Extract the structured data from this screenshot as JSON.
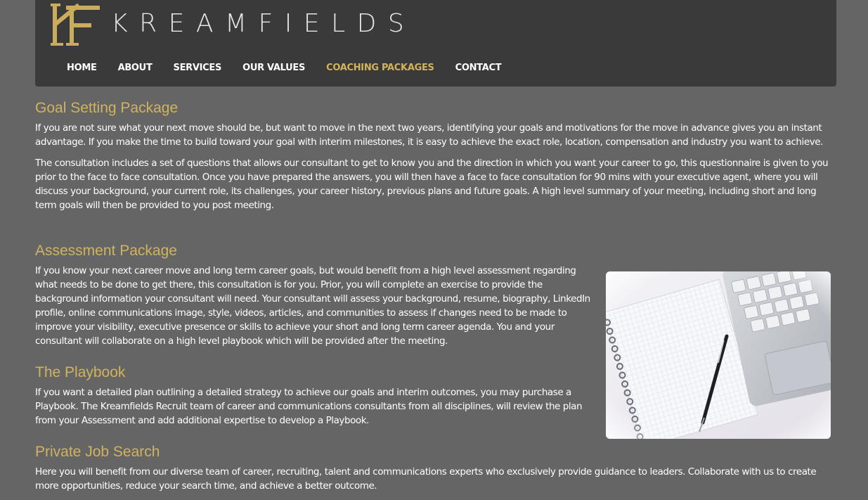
{
  "brand": {
    "name": "KREAMFIELDS",
    "mark_color": "#c9ad5d"
  },
  "nav": {
    "items": [
      {
        "label": "HOME"
      },
      {
        "label": "ABOUT"
      },
      {
        "label": "SERVICES"
      },
      {
        "label": "OUR VALUES"
      },
      {
        "label": "COACHING PACKAGES",
        "active": true
      },
      {
        "label": "CONTACT"
      }
    ]
  },
  "colors": {
    "accent": "#d1b35e",
    "background": "#656565",
    "header": "#3b3a3b"
  },
  "sections": [
    {
      "title": "Goal Setting Package",
      "paragraphs": [
        "If you are not sure what your next move should be, but want to move in the next two years, identifying your goals and motivations for the move in advance gives you an instant advantage. If you make the time to build toward your goal with interim milestones, it is easy to achieve the exact role, location, compensation and industry you want to achieve.",
        "The consultation includes a set of questions that allows our consultant to get to know you and the direction in which you want your career to go, this questionnaire is given to you prior to the face to face consultation. Once you have prepared the answers, you will then have a face to face consultation for 90 mins with your executive agent, where you will discuss your background, your current role, its challenges, your career history, previous plans and future goals. A high level summary of your meeting, including short and long term goals will then be provided to you post meeting."
      ]
    },
    {
      "title": "Assessment Package",
      "paragraphs": [
        "If you know your next career move and long term career goals, but would benefit from a high level assessment regarding what needs to be done to get there, this consultation is for you. Prior, you will complete an exercise to provide the background information your consultant will need. Your consultant will assess your background, resume, biography, LinkedIn profile, online communications image, style, videos, articles, and communities to assess if changes need to be made to improve your visibility, executive presence or skills to achieve your short and long term career agenda. You and your consultant will collaborate on a high level playbook which will be provided after the meeting."
      ]
    },
    {
      "title": "The Playbook",
      "paragraphs": [
        "If you want a detailed plan outlining a detailed strategy to achieve our goals and interim outcomes, you may purchase a Playbook. The Kreamfields Recruit team of career and communications consultants from all disciplines, will review the plan from your Assessment and add additional expertise to develop a Playbook."
      ]
    },
    {
      "title": "Private Job Search",
      "paragraphs": [
        "Here you will benefit from our diverse team of career, recruiting, talent and communications experts who exclusively provide guidance to leaders. Collaborate with us to create more opportunities, reduce your search time, and achieve a better outcome."
      ]
    }
  ]
}
